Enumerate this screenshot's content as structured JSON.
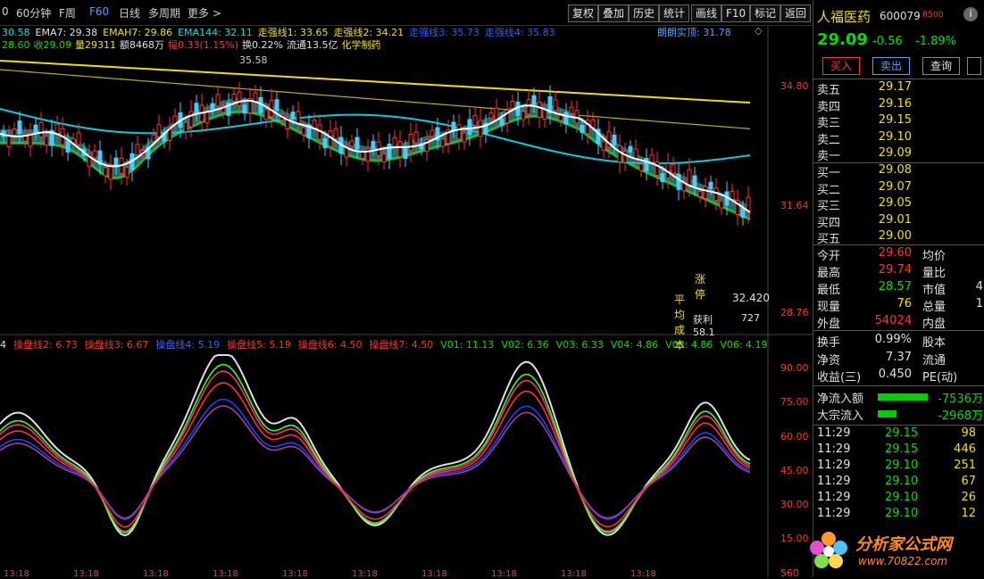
{
  "toolbar": {
    "items": [
      "0",
      "60分钟",
      "F周",
      "F60",
      "日线",
      "多周期",
      "更多 >"
    ],
    "active_index": 3,
    "right_buttons": [
      "复权",
      "叠加",
      "历史",
      "统计",
      "画线",
      "F10",
      "标记",
      "返回"
    ]
  },
  "info_line1": [
    {
      "text": "30.58",
      "color": "#00e0e0"
    },
    {
      "text": "EMA7: 29.38",
      "color": "#e0e0e0"
    },
    {
      "text": "EMAH7: 29.86",
      "color": "#f0e000"
    },
    {
      "text": "EMA144: 32.11",
      "color": "#00e0e0"
    },
    {
      "text": "走强线1: 33.65",
      "color": "#f0e000"
    },
    {
      "text": "走强线2: 34.21",
      "color": "#f0e000"
    },
    {
      "text": "走强线3: 35.73",
      "color": "#2060ff"
    },
    {
      "text": "走强线4: 35.83",
      "color": "#2060ff"
    }
  ],
  "info_line1_right": "朗朗实顶: 31.78",
  "info_line2": [
    {
      "text": "28.60",
      "color": "#00e000"
    },
    {
      "text": "收29.09",
      "color": "#00e000"
    },
    {
      "text": "量29311",
      "color": "#f0e000"
    },
    {
      "text": "额8468万",
      "color": "#e0e0e0"
    },
    {
      "text": "幅0.33(1.15%)",
      "color": "#ff3333"
    },
    {
      "text": "换0.22%",
      "color": "#e0e0e0"
    },
    {
      "text": "流通13.5亿",
      "color": "#e0e0e0"
    },
    {
      "text": "化学制药",
      "color": "#f0e000"
    }
  ],
  "price_axis": [
    "34.80",
    "31.64",
    "28.76"
  ],
  "peak_label": "35.58",
  "annotations": {
    "zhangting": "涨停",
    "avg_cost": "平均成本",
    "avg_cost_val": "32.420",
    "profit": "获利58.1",
    "profit_val": "727"
  },
  "indicator_line": [
    {
      "text": "4",
      "color": "#e0e0e0"
    },
    {
      "text": "操盘线2: 6.73",
      "color": "#ff3030"
    },
    {
      "text": "操盘线3: 6.67",
      "color": "#ff3030"
    },
    {
      "text": "操盘线4: 5.19",
      "color": "#4060ff"
    },
    {
      "text": "操盘线5: 5.19",
      "color": "#ff3030"
    },
    {
      "text": "操盘线6: 4.50",
      "color": "#ff3030"
    },
    {
      "text": "操盘线7: 4.50",
      "color": "#ff3030"
    },
    {
      "text": "V01: 11.13",
      "color": "#00e000"
    },
    {
      "text": "V02: 6.36",
      "color": "#00e000"
    },
    {
      "text": "V03: 6.33",
      "color": "#00e000"
    },
    {
      "text": "V04: 4.86",
      "color": "#00e000"
    },
    {
      "text": "V05: 4.86",
      "color": "#00e000"
    },
    {
      "text": "V06: 4.19",
      "color": "#00e000"
    },
    {
      "text": "V07: 4.1",
      "color": "#00e000"
    }
  ],
  "indicator_axis": [
    "90.00",
    "75.00",
    "60.00",
    "45.00",
    "30.00",
    "15.00"
  ],
  "time_axis": [
    "13:18",
    "13:18",
    "13:18",
    "13:18",
    "13:18",
    "13:18",
    "13:18",
    "13:18",
    "13:18",
    "13:18"
  ],
  "bottom_right_axis": "560",
  "stock": {
    "name": "人福医药",
    "code": "600079",
    "badge": "R500",
    "price": "29.09",
    "change": "-0.56",
    "change_pct": "-1.89%"
  },
  "trade_buttons": {
    "buy": "买入",
    "sell": "卖出",
    "query": "查询"
  },
  "asks": [
    {
      "label": "卖五",
      "price": "29.17"
    },
    {
      "label": "卖四",
      "price": "29.16"
    },
    {
      "label": "卖三",
      "price": "29.15"
    },
    {
      "label": "卖二",
      "price": "29.10"
    },
    {
      "label": "卖一",
      "price": "29.09"
    }
  ],
  "bids": [
    {
      "label": "买一",
      "price": "29.08"
    },
    {
      "label": "买二",
      "price": "29.07"
    },
    {
      "label": "买三",
      "price": "29.05"
    },
    {
      "label": "买四",
      "price": "29.01"
    },
    {
      "label": "买五",
      "price": "29.00"
    }
  ],
  "stats": [
    {
      "l": "今开",
      "v": "29.60",
      "vc": "#ff3333",
      "l2": "均价",
      "v2": ""
    },
    {
      "l": "最高",
      "v": "29.74",
      "vc": "#ff3333",
      "l2": "量比",
      "v2": ""
    },
    {
      "l": "最低",
      "v": "28.57",
      "vc": "#00e000",
      "l2": "市值",
      "v2": "4"
    },
    {
      "l": "现量",
      "v": "76",
      "vc": "#f0e000",
      "l2": "总量",
      "v2": "1"
    },
    {
      "l": "外盘",
      "v": "54024",
      "vc": "#ff3333",
      "l2": "内盘",
      "v2": ""
    }
  ],
  "stats2": [
    {
      "l": "换手",
      "v": "0.99%",
      "l2": "股本"
    },
    {
      "l": "净资",
      "v": "7.37",
      "l2": "流通"
    },
    {
      "l": "收益(三)",
      "v": "0.450",
      "l2": "PE(动)"
    }
  ],
  "flows": [
    {
      "l": "净流入额",
      "v": "-7536万",
      "bar": 0.8
    },
    {
      "l": "大宗流入",
      "v": "-2968万",
      "bar": 0.3
    }
  ],
  "ticks": [
    {
      "t": "11:29",
      "p": "29.15",
      "v": "98"
    },
    {
      "t": "11:29",
      "p": "29.15",
      "v": "446"
    },
    {
      "t": "11:29",
      "p": "29.10",
      "v": "251"
    },
    {
      "t": "11:29",
      "p": "29.10",
      "v": "67"
    },
    {
      "t": "11:29",
      "p": "29.10",
      "v": "26"
    },
    {
      "t": "11:29",
      "p": "29.10",
      "v": "12"
    }
  ],
  "watermark": {
    "text": "分析家公式网",
    "url": "www.70822.com"
  }
}
